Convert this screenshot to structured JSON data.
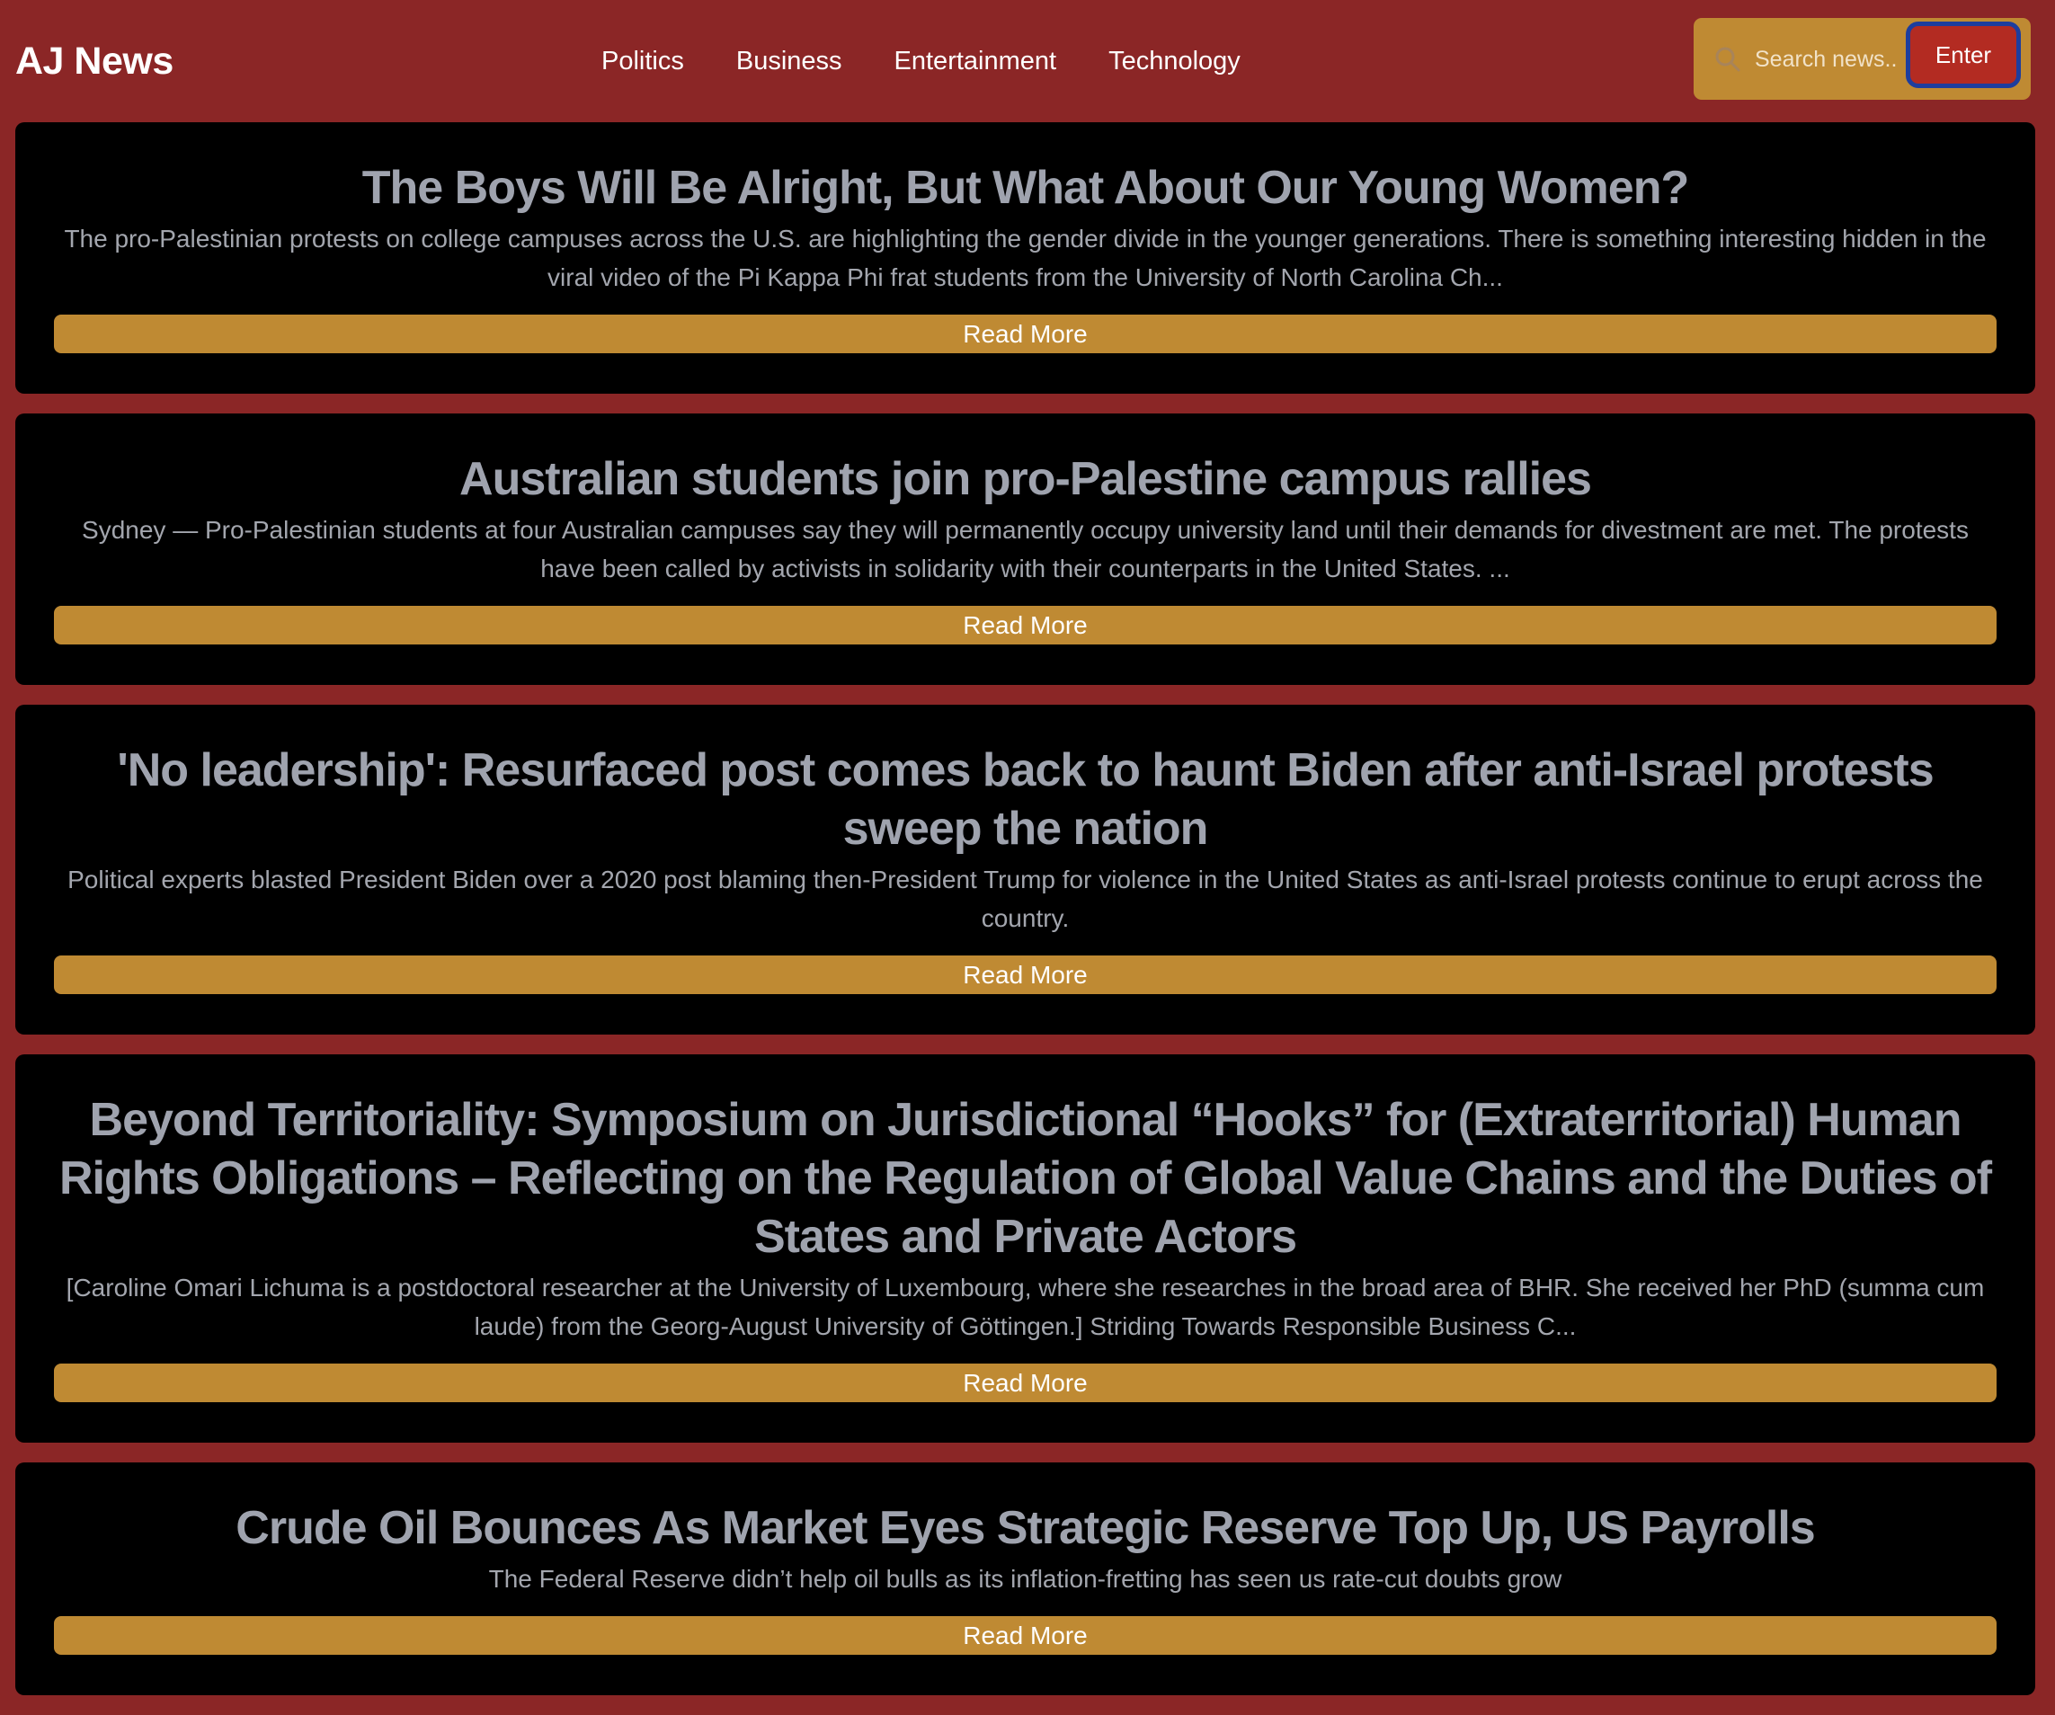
{
  "header": {
    "brand": "AJ News",
    "nav": [
      "Politics",
      "Business",
      "Entertainment",
      "Technology"
    ],
    "search": {
      "placeholder": "Search news...",
      "enter_label": "Enter"
    }
  },
  "articles": [
    {
      "title": "The Boys Will Be Alright, But What About Our Young Women?",
      "excerpt": "The pro-Palestinian protests on college campuses across the U.S. are highlighting the gender divide in the younger generations. There is something interesting hidden in the viral video of the Pi Kappa Phi frat students from the University of North Carolina Ch...",
      "read_more": "Read More"
    },
    {
      "title": "Australian students join pro-Palestine campus rallies",
      "excerpt": "Sydney — Pro-Palestinian students at four Australian campuses say they will permanently occupy university land until their demands for divestment are met. The protests have been called by activists in solidarity with their counterparts in the United States. ...",
      "read_more": "Read More"
    },
    {
      "title": "'No leadership': Resurfaced post comes back to haunt Biden after anti-Israel protests sweep the nation",
      "excerpt": "Political experts blasted President Biden over a 2020 post blaming then-President Trump for violence in the United States as anti-Israel protests continue to erupt across the country.",
      "read_more": "Read More"
    },
    {
      "title": "Beyond Territoriality: Symposium on Jurisdictional “Hooks” for (Extraterritorial) Human Rights Obligations – Reflecting on the Regulation of Global Value Chains and the Duties of States and Private Actors",
      "excerpt": "[Caroline Omari Lichuma is a postdoctoral researcher at the University of Luxembourg, where she researches in the broad area of BHR. She received her PhD (summa cum laude) from the Georg-August University of Göttingen.] Striding Towards Responsible Business C...",
      "read_more": "Read More"
    },
    {
      "title": "Crude Oil Bounces As Market Eyes Strategic Reserve Top Up, US Payrolls",
      "excerpt": "The Federal Reserve didn’t help oil bulls as its inflation-fretting has seen us rate-cut doubts grow",
      "read_more": "Read More"
    }
  ],
  "colors": {
    "page_background": "#8B2626",
    "card_background": "#000000",
    "accent": "#BF8A33",
    "enter_button": "#B32B22",
    "enter_button_outline": "#1D3D9E",
    "headline": "#9FA3AE"
  }
}
